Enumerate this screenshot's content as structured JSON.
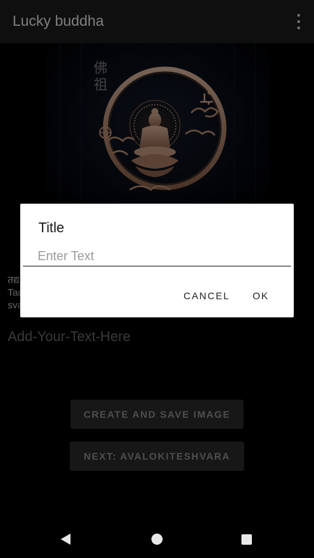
{
  "appbar": {
    "title": "Lucky buddha",
    "menu_icon": "overflow-menu-icon"
  },
  "hero": {
    "calligraphy": [
      "佛",
      "祖"
    ]
  },
  "background_text": {
    "line1": "तद्य",
    "line2": "Tad",
    "line3": "sva"
  },
  "main": {
    "add_text": "Add-Your-Text-Here",
    "create_button": "CREATE AND SAVE IMAGE",
    "next_button": "NEXT: AVALOKITESHVARA"
  },
  "dialog": {
    "title": "Title",
    "input_placeholder": "Enter Text",
    "input_value": "",
    "cancel_label": "CANCEL",
    "ok_label": "OK"
  },
  "navbar": {
    "back_icon": "back-icon",
    "home_icon": "home-icon",
    "recents_icon": "recents-icon"
  },
  "colors": {
    "appbar": "#1c1c1c",
    "dialog_bg": "#ffffff",
    "button_bg": "#2a2a2a",
    "wood": "#b98f74"
  }
}
